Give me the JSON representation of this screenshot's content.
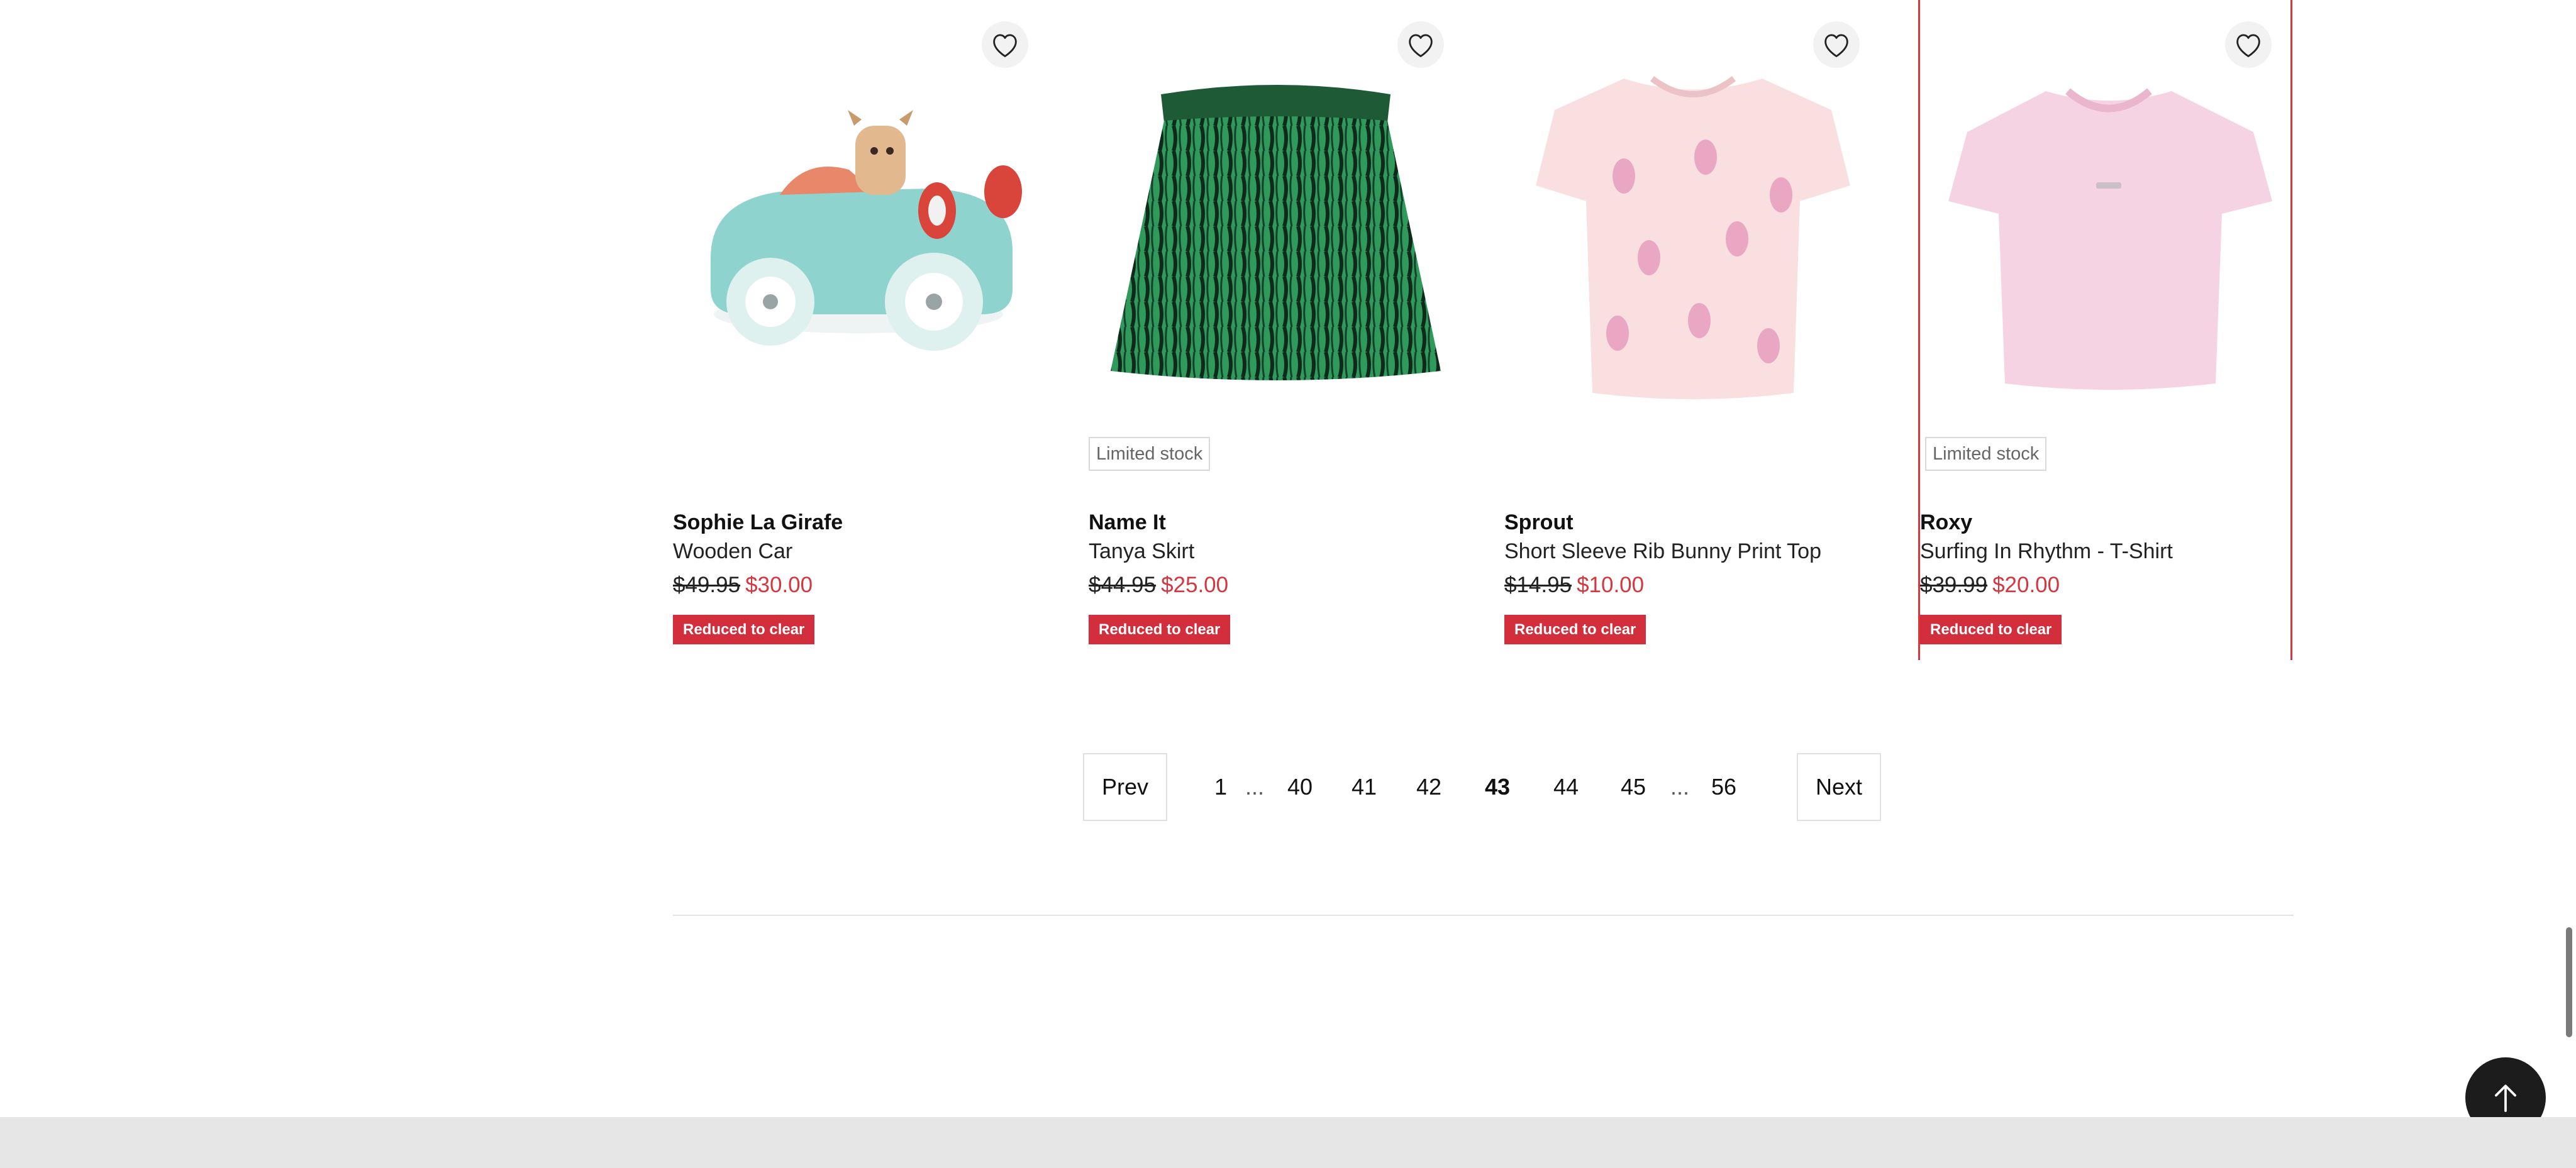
{
  "products": [
    {
      "brand": "Sophie La Girafe",
      "title": "Wooden Car",
      "price_old": "$49.95",
      "price_new": "$30.00",
      "stock_label": "",
      "promo_label": "Reduced to clear",
      "image": "wooden-toy-car"
    },
    {
      "brand": "Name It",
      "title": "Tanya Skirt",
      "price_old": "$44.95",
      "price_new": "$25.00",
      "stock_label": "Limited stock",
      "promo_label": "Reduced to clear",
      "image": "green-skirt"
    },
    {
      "brand": "Sprout",
      "title": "Short Sleeve Rib Bunny Print Top",
      "price_old": "$14.95",
      "price_new": "$10.00",
      "stock_label": "",
      "promo_label": "Reduced to clear",
      "image": "pink-bunny-top"
    },
    {
      "brand": "Roxy",
      "title": "Surfing In Rhythm - T-Shirt",
      "price_old": "$39.99",
      "price_new": "$20.00",
      "stock_label": "Limited stock",
      "promo_label": "Reduced to clear",
      "image": "pink-tshirt"
    }
  ],
  "pagination": {
    "prev_label": "Prev",
    "next_label": "Next",
    "first": "1",
    "ellipsis": "...",
    "pages": [
      "40",
      "41",
      "42",
      "43",
      "44",
      "45"
    ],
    "current": "43",
    "last": "56"
  },
  "icons": {
    "wishlist": "heart-outline-icon",
    "back_to_top": "arrow-up-icon"
  },
  "colors": {
    "sale_price": "#d4373f",
    "promo_badge": "#d22e3c",
    "highlight_border": "#d4373f"
  }
}
